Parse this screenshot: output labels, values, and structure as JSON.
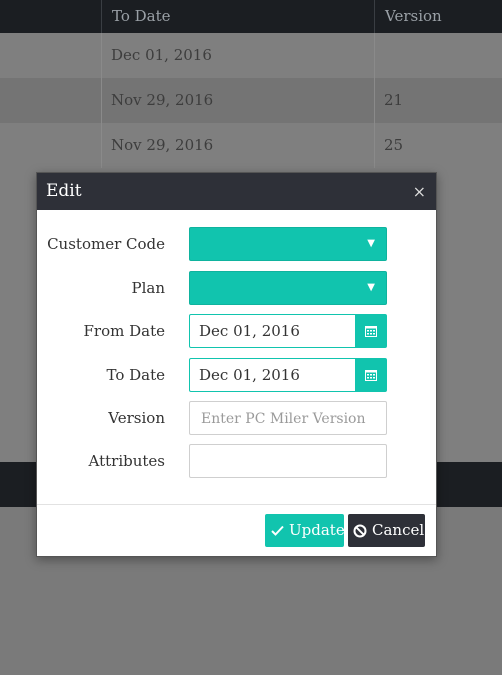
{
  "background_table": {
    "headers": {
      "to_date": "To Date",
      "version": "Version"
    },
    "rows": [
      {
        "to_date": "Dec 01, 2016",
        "version": ""
      },
      {
        "to_date": "Nov 29, 2016",
        "version": "21"
      },
      {
        "to_date": "Nov 29, 2016",
        "version": "25"
      }
    ]
  },
  "modal": {
    "title": "Edit",
    "close_glyph": "×",
    "fields": {
      "customer_code": {
        "label": "Customer Code",
        "value": ""
      },
      "plan": {
        "label": "Plan",
        "value": ""
      },
      "from_date": {
        "label": "From Date",
        "value": "Dec 01, 2016"
      },
      "to_date": {
        "label": "To Date",
        "value": "Dec 01, 2016"
      },
      "version": {
        "label": "Version",
        "value": "",
        "placeholder": "Enter PC Miler Version"
      },
      "attributes": {
        "label": "Attributes",
        "value": ""
      }
    },
    "buttons": {
      "update": "Update",
      "cancel": "Cancel"
    }
  },
  "colors": {
    "accent": "#11c4ae",
    "dark": "#2e3038",
    "overlay": "#7a7a7a"
  },
  "icons": {
    "dropdown": "chevron-down-icon",
    "calendar": "calendar-icon",
    "update": "check-icon",
    "cancel": "ban-icon",
    "close": "close-icon"
  }
}
